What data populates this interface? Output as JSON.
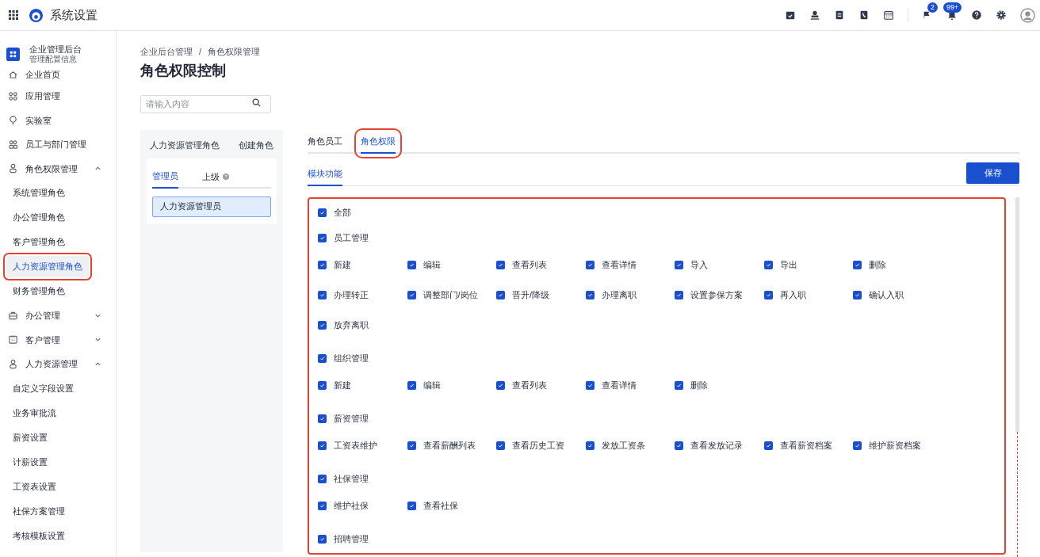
{
  "app": {
    "title": "系统设置"
  },
  "topbar": {
    "badges": [
      "2",
      "99+"
    ]
  },
  "sidebar": {
    "org": {
      "name": "企业管理后台",
      "subtitle": "管理配置信息"
    },
    "items": [
      {
        "label": "企业首页"
      },
      {
        "label": "应用管理"
      },
      {
        "label": "实验室"
      },
      {
        "label": "员工与部门管理"
      },
      {
        "label": "角色权限管理",
        "expanded": true,
        "children": [
          {
            "label": "系统管理角色",
            "selected": false
          },
          {
            "label": "办公管理角色",
            "selected": false
          },
          {
            "label": "客户管理角色",
            "selected": false
          },
          {
            "label": "人力资源管理角色",
            "selected": true
          },
          {
            "label": "财务管理角色",
            "selected": false
          }
        ]
      },
      {
        "label": "办公管理",
        "expanded": false
      },
      {
        "label": "客户管理",
        "expanded": false
      },
      {
        "label": "人力资源管理",
        "expanded": true,
        "children": [
          {
            "label": "自定义字段设置",
            "selected": false
          },
          {
            "label": "业务审批流",
            "selected": false
          },
          {
            "label": "薪资设置",
            "selected": false
          },
          {
            "label": "计薪设置",
            "selected": false
          },
          {
            "label": "工资表设置",
            "selected": false
          },
          {
            "label": "社保方案管理",
            "selected": false
          },
          {
            "label": "考核模板设置",
            "selected": false
          }
        ]
      }
    ]
  },
  "breadcrumb": {
    "separator": "/",
    "items": [
      "企业后台管理",
      "角色权限管理"
    ]
  },
  "page_title": "角色权限控制",
  "search": {
    "placeholder": "请输入内容"
  },
  "role_panel": {
    "title": "人力资源管理角色",
    "action": "创建角色",
    "tabs": [
      {
        "label": "管理员",
        "selected": true
      },
      {
        "label": "上级",
        "selected": false
      }
    ],
    "members": [
      {
        "label": "人力资源管理员",
        "selected": true
      }
    ]
  },
  "tabs": [
    {
      "label": "角色员工",
      "selected": false
    },
    {
      "label": "角色权限",
      "selected": true
    }
  ],
  "subtabs": [
    {
      "label": "模块功能",
      "selected": true
    }
  ],
  "save": "保存",
  "permissions": {
    "all": {
      "label": "全部",
      "checked": true
    },
    "groups": [
      {
        "label": "员工管理",
        "checked": true,
        "items": [
          {
            "label": "新建",
            "checked": true
          },
          {
            "label": "编辑",
            "checked": true
          },
          {
            "label": "查看列表",
            "checked": true
          },
          {
            "label": "查看详情",
            "checked": true
          },
          {
            "label": "导入",
            "checked": true
          },
          {
            "label": "导出",
            "checked": true
          },
          {
            "label": "删除",
            "checked": true
          },
          {
            "label": "办理转正",
            "checked": true
          },
          {
            "label": "调整部门/岗位",
            "checked": true
          },
          {
            "label": "晋升/降级",
            "checked": true
          },
          {
            "label": "办理离职",
            "checked": true
          },
          {
            "label": "设置参保方案",
            "checked": true
          },
          {
            "label": "再入职",
            "checked": true
          },
          {
            "label": "确认入职",
            "checked": true
          },
          {
            "label": "放弃离职",
            "checked": true
          }
        ]
      },
      {
        "label": "组织管理",
        "checked": true,
        "items": [
          {
            "label": "新建",
            "checked": true
          },
          {
            "label": "编辑",
            "checked": true
          },
          {
            "label": "查看列表",
            "checked": true
          },
          {
            "label": "查看详情",
            "checked": true
          },
          {
            "label": "删除",
            "checked": true
          }
        ]
      },
      {
        "label": "薪资管理",
        "checked": true,
        "items": [
          {
            "label": "工资表维护",
            "checked": true
          },
          {
            "label": "查看薪酬列表",
            "checked": true
          },
          {
            "label": "查看历史工资",
            "checked": true
          },
          {
            "label": "发放工资条",
            "checked": true
          },
          {
            "label": "查看发放记录",
            "checked": true
          },
          {
            "label": "查看薪资档案",
            "checked": true
          },
          {
            "label": "维护薪资档案",
            "checked": true
          }
        ]
      },
      {
        "label": "社保管理",
        "checked": true,
        "items": [
          {
            "label": "维护社保",
            "checked": true
          },
          {
            "label": "查看社保",
            "checked": true
          }
        ]
      },
      {
        "label": "招聘管理",
        "checked": true
      }
    ]
  }
}
